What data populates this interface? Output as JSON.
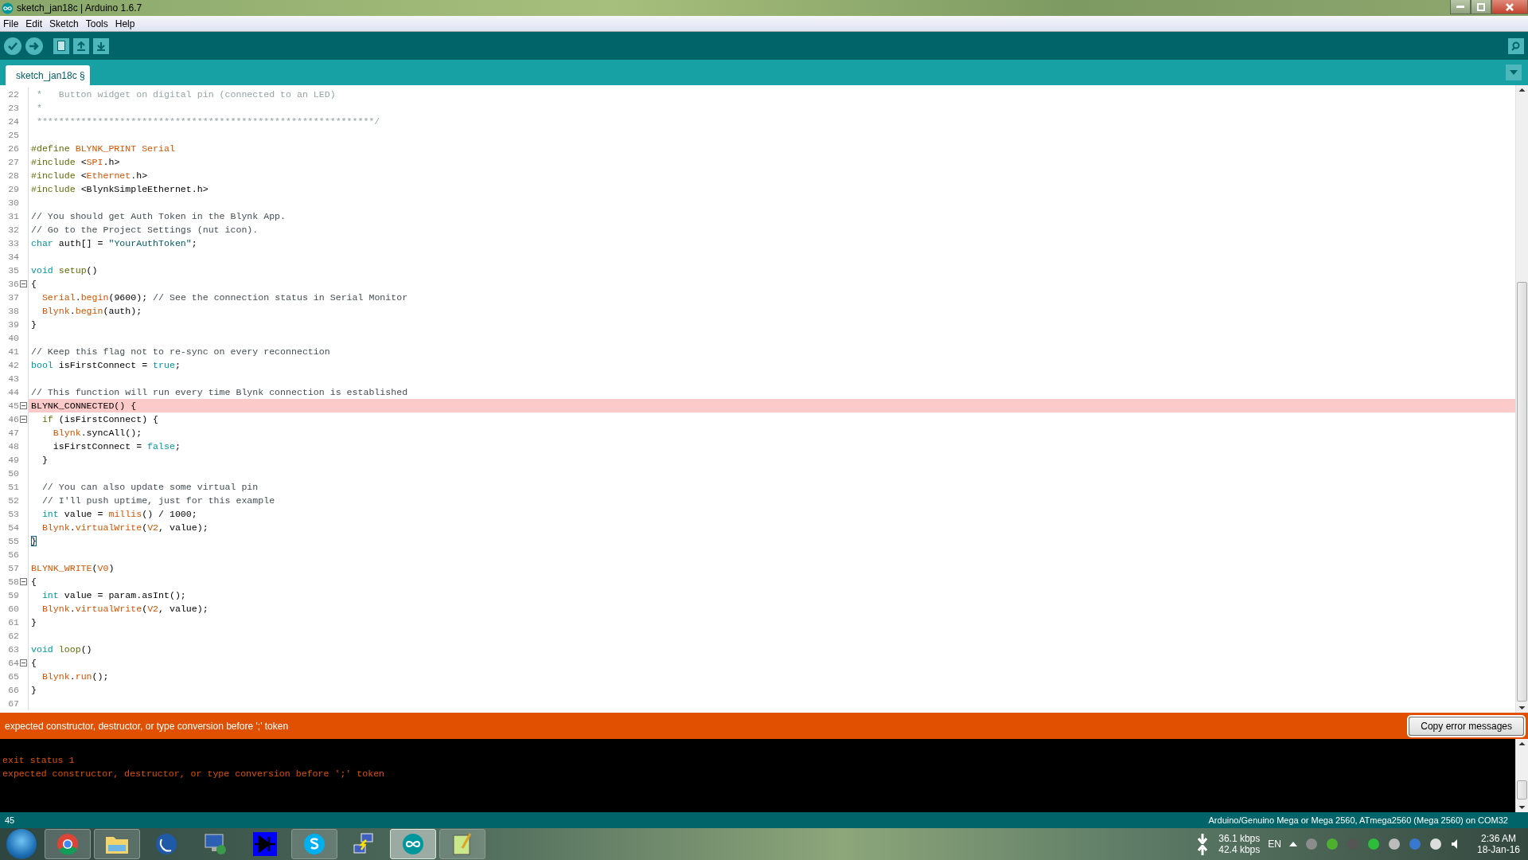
{
  "window": {
    "title": "sketch_jan18c | Arduino 1.6.7"
  },
  "menu": [
    "File",
    "Edit",
    "Sketch",
    "Tools",
    "Help"
  ],
  "tabs": [
    {
      "label": "sketch_jan18c §",
      "selected": true
    }
  ],
  "lines": [
    {
      "number": "22",
      "segments": [
        {
          "kind": "block",
          "text": " *   Button widget on digital pin (connected to an LED)"
        }
      ]
    },
    {
      "number": "23",
      "segments": [
        {
          "kind": "block",
          "text": " *"
        }
      ]
    },
    {
      "number": "24",
      "segments": [
        {
          "kind": "block",
          "text": " *************************************************************/"
        }
      ]
    },
    {
      "number": "25"
    },
    {
      "number": "26",
      "segments": [
        {
          "kind": "pre",
          "text": "#define "
        },
        {
          "kind": "func",
          "text": "BLYNK_PRINT Serial"
        }
      ]
    },
    {
      "number": "27",
      "segments": [
        {
          "kind": "pre",
          "text": "#include "
        },
        {
          "kind": "plain",
          "text": "<"
        },
        {
          "kind": "func",
          "text": "SPI"
        },
        {
          "kind": "plain",
          "text": ".h>"
        }
      ]
    },
    {
      "number": "28",
      "segments": [
        {
          "kind": "pre",
          "text": "#include "
        },
        {
          "kind": "plain",
          "text": "<"
        },
        {
          "kind": "func",
          "text": "Ethernet"
        },
        {
          "kind": "plain",
          "text": ".h>"
        }
      ]
    },
    {
      "number": "29",
      "segments": [
        {
          "kind": "pre",
          "text": "#include "
        },
        {
          "kind": "plain",
          "text": "<BlynkSimpleEthernet.h>"
        }
      ]
    },
    {
      "number": "30"
    },
    {
      "number": "31",
      "segments": [
        {
          "kind": "comment",
          "text": "// You should get Auth Token in the Blynk App."
        }
      ]
    },
    {
      "number": "32",
      "segments": [
        {
          "kind": "comment",
          "text": "// Go to the Project Settings (nut icon)."
        }
      ]
    },
    {
      "number": "33",
      "segments": [
        {
          "kind": "type",
          "text": "char"
        },
        {
          "kind": "plain",
          "text": " auth[] = "
        },
        {
          "kind": "str",
          "text": "\"YourAuthToken\""
        },
        {
          "kind": "plain",
          "text": ";"
        }
      ]
    },
    {
      "number": "34"
    },
    {
      "number": "35",
      "segments": [
        {
          "kind": "type",
          "text": "void "
        },
        {
          "kind": "pre",
          "text": "setup"
        },
        {
          "kind": "plain",
          "text": "()"
        }
      ]
    },
    {
      "number": "36",
      "fold": true,
      "segments": [
        {
          "kind": "plain",
          "text": "{"
        }
      ]
    },
    {
      "number": "37",
      "segments": [
        {
          "kind": "func",
          "text": "  Serial"
        },
        {
          "kind": "plain",
          "text": "."
        },
        {
          "kind": "func",
          "text": "begin"
        },
        {
          "kind": "plain",
          "text": "(9600); "
        },
        {
          "kind": "comment",
          "text": "// See the connection status in Serial Monitor"
        }
      ]
    },
    {
      "number": "38",
      "segments": [
        {
          "kind": "func",
          "text": "  Blynk"
        },
        {
          "kind": "plain",
          "text": "."
        },
        {
          "kind": "func",
          "text": "begin"
        },
        {
          "kind": "plain",
          "text": "(auth);"
        }
      ]
    },
    {
      "number": "39",
      "segments": [
        {
          "kind": "plain",
          "text": "}"
        }
      ]
    },
    {
      "number": "40"
    },
    {
      "number": "41",
      "segments": [
        {
          "kind": "comment",
          "text": "// Keep this flag not to re-sync on every reconnection"
        }
      ]
    },
    {
      "number": "42",
      "segments": [
        {
          "kind": "type",
          "text": "bool"
        },
        {
          "kind": "plain",
          "text": " isFirstConnect = "
        },
        {
          "kind": "type",
          "text": "true"
        },
        {
          "kind": "plain",
          "text": ";"
        }
      ]
    },
    {
      "number": "43"
    },
    {
      "number": "44",
      "segments": [
        {
          "kind": "comment",
          "text": "// This function will run every time Blynk connection is established"
        }
      ]
    },
    {
      "number": "45",
      "fold": true,
      "highlighted": true,
      "segments": [
        {
          "kind": "plain",
          "text": "BLYNK_CONNECTED() {"
        }
      ]
    },
    {
      "number": "46",
      "fold": true,
      "segments": [
        {
          "kind": "pre",
          "text": "  if"
        },
        {
          "kind": "plain",
          "text": " (isFirstConnect) {"
        }
      ]
    },
    {
      "number": "47",
      "segments": [
        {
          "kind": "func",
          "text": "    Blynk"
        },
        {
          "kind": "plain",
          "text": ".syncAll();"
        }
      ]
    },
    {
      "number": "48",
      "segments": [
        {
          "kind": "plain",
          "text": "    isFirstConnect = "
        },
        {
          "kind": "type",
          "text": "false"
        },
        {
          "kind": "plain",
          "text": ";"
        }
      ]
    },
    {
      "number": "49",
      "segments": [
        {
          "kind": "plain",
          "text": "  }"
        }
      ]
    },
    {
      "number": "50"
    },
    {
      "number": "51",
      "segments": [
        {
          "kind": "comment",
          "text": "  // You can also update some virtual pin"
        }
      ]
    },
    {
      "number": "52",
      "segments": [
        {
          "kind": "comment",
          "text": "  // I'll push uptime, just for this example"
        }
      ]
    },
    {
      "number": "53",
      "segments": [
        {
          "kind": "type",
          "text": "  int"
        },
        {
          "kind": "plain",
          "text": " value = "
        },
        {
          "kind": "func",
          "text": "millis"
        },
        {
          "kind": "plain",
          "text": "() / 1000;"
        }
      ]
    },
    {
      "number": "54",
      "segments": [
        {
          "kind": "func",
          "text": "  Blynk"
        },
        {
          "kind": "plain",
          "text": "."
        },
        {
          "kind": "func",
          "text": "virtualWrite"
        },
        {
          "kind": "plain",
          "text": "("
        },
        {
          "kind": "func",
          "text": "V2"
        },
        {
          "kind": "plain",
          "text": ", value);"
        }
      ]
    },
    {
      "number": "55",
      "segments": [
        {
          "kind": "bracket",
          "text": "}"
        }
      ]
    },
    {
      "number": "56"
    },
    {
      "number": "57",
      "segments": [
        {
          "kind": "func",
          "text": "BLYNK_WRITE"
        },
        {
          "kind": "plain",
          "text": "("
        },
        {
          "kind": "func",
          "text": "V0"
        },
        {
          "kind": "plain",
          "text": ")"
        }
      ]
    },
    {
      "number": "58",
      "fold": true,
      "segments": [
        {
          "kind": "plain",
          "text": "{"
        }
      ]
    },
    {
      "number": "59",
      "segments": [
        {
          "kind": "type",
          "text": "  int"
        },
        {
          "kind": "plain",
          "text": " value = param.asInt();"
        }
      ]
    },
    {
      "number": "60",
      "segments": [
        {
          "kind": "func",
          "text": "  Blynk"
        },
        {
          "kind": "plain",
          "text": "."
        },
        {
          "kind": "func",
          "text": "virtualWrite"
        },
        {
          "kind": "plain",
          "text": "("
        },
        {
          "kind": "func",
          "text": "V2"
        },
        {
          "kind": "plain",
          "text": ", value);"
        }
      ]
    },
    {
      "number": "61",
      "segments": [
        {
          "kind": "plain",
          "text": "}"
        }
      ]
    },
    {
      "number": "62"
    },
    {
      "number": "63",
      "segments": [
        {
          "kind": "type",
          "text": "void "
        },
        {
          "kind": "pre",
          "text": "loop"
        },
        {
          "kind": "plain",
          "text": "()"
        }
      ]
    },
    {
      "number": "64",
      "fold": true,
      "segments": [
        {
          "kind": "plain",
          "text": "{"
        }
      ]
    },
    {
      "number": "65",
      "segments": [
        {
          "kind": "func",
          "text": "  Blynk"
        },
        {
          "kind": "plain",
          "text": "."
        },
        {
          "kind": "func",
          "text": "run"
        },
        {
          "kind": "plain",
          "text": "();"
        }
      ]
    },
    {
      "number": "66",
      "segments": [
        {
          "kind": "plain",
          "text": "}"
        }
      ]
    },
    {
      "number": "67"
    }
  ],
  "error_bar": {
    "message": "expected constructor, destructor, or type conversion before ';' token",
    "button": "Copy error messages"
  },
  "console": [
    "exit status 1",
    "expected constructor, destructor, or type conversion before ';' token"
  ],
  "status_bar": {
    "line": "45",
    "board": "Arduino/Genuino Mega or Mega 2560, ATmega2560 (Mega 2560) on COM32"
  },
  "taskbar": {
    "apps": [
      {
        "kind": "chrome",
        "running": true,
        "selected": false
      },
      {
        "kind": "folder",
        "running": true,
        "selected": false
      },
      {
        "kind": "moon",
        "running": false,
        "selected": false
      },
      {
        "kind": "remote",
        "running": false,
        "selected": false
      },
      {
        "kind": "diode",
        "running": false,
        "selected": false
      },
      {
        "kind": "skype",
        "running": true,
        "selected": false
      },
      {
        "kind": "network",
        "running": false,
        "selected": false
      },
      {
        "kind": "arduino",
        "running": true,
        "selected": true
      },
      {
        "kind": "notepad",
        "running": true,
        "selected": false
      }
    ],
    "download": "36.1 kbps",
    "upload": "42.4 kbps",
    "language": "EN",
    "time": "2:36 AM",
    "date": "18-Jan-16"
  }
}
